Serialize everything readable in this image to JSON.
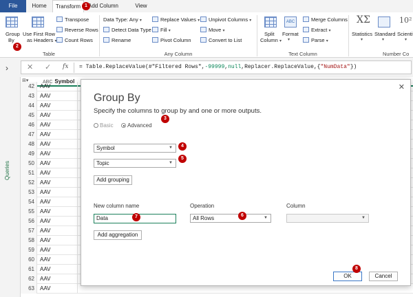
{
  "tabs": {
    "file": "File",
    "home": "Home",
    "transform": "Transform",
    "add_column": "Add Column",
    "view": "View"
  },
  "ribbon": {
    "group_by_line1": "Group",
    "group_by_line2": "By",
    "use_first_row_line1": "Use First Row",
    "use_first_row_line2": "as Headers",
    "transpose": "Transpose",
    "reverse_rows": "Reverse Rows",
    "count_rows": "Count Rows",
    "group_table": "Table",
    "data_type": "Data Type: Any",
    "detect_data_type": "Detect Data Type",
    "rename": "Rename",
    "replace_values": "Replace Values",
    "fill": "Fill",
    "pivot_column": "Pivot Column",
    "unpivot_columns": "Unpivot Columns",
    "move": "Move",
    "convert_to_list": "Convert to List",
    "group_any_column": "Any Column",
    "split_line1": "Split",
    "split_line2": "Column",
    "format": "Format",
    "merge_columns": "Merge Columns",
    "extract": "Extract",
    "parse": "Parse",
    "group_text_column": "Text Column",
    "statistics": "Statistics",
    "standard": "Standard",
    "scientific": "Scientific",
    "group_number_column": "Number Co",
    "abc_glyph": "ABC",
    "sigma_glyph": "XΣ",
    "exp_glyph": "10²"
  },
  "formula_bar": {
    "chevron": "›",
    "cancel_icon": "✕",
    "confirm_icon": "✓",
    "fx": "fx",
    "p1": "= Table.ReplaceValue(#\"Filtered Rows\",",
    "p2": "-99999",
    "p3": ",",
    "p4": "null",
    "p5": ",Replacer.ReplaceValue,{",
    "p6": "\"NumData\"",
    "p7": "})"
  },
  "queries_label": "Queries",
  "grid": {
    "type_icon": "ABC",
    "column": "Symbol",
    "rows": [
      {
        "n": "42",
        "v": "AAV"
      },
      {
        "n": "43",
        "v": "AAV"
      },
      {
        "n": "44",
        "v": "AAV"
      },
      {
        "n": "45",
        "v": "AAV"
      },
      {
        "n": "46",
        "v": "AAV"
      },
      {
        "n": "47",
        "v": "AAV"
      },
      {
        "n": "48",
        "v": "AAV"
      },
      {
        "n": "49",
        "v": "AAV"
      },
      {
        "n": "50",
        "v": "AAV"
      },
      {
        "n": "51",
        "v": "AAV"
      },
      {
        "n": "52",
        "v": "AAV"
      },
      {
        "n": "53",
        "v": "AAV"
      },
      {
        "n": "54",
        "v": "AAV"
      },
      {
        "n": "55",
        "v": "AAV"
      },
      {
        "n": "56",
        "v": "AAV"
      },
      {
        "n": "57",
        "v": "AAV"
      },
      {
        "n": "58",
        "v": "AAV"
      },
      {
        "n": "59",
        "v": "AAV"
      },
      {
        "n": "60",
        "v": "AAV"
      },
      {
        "n": "61",
        "v": "AAV"
      },
      {
        "n": "62",
        "v": "AAV"
      },
      {
        "n": "63",
        "v": "AAV"
      }
    ]
  },
  "dialog": {
    "title": "Group By",
    "subtitle": "Specify the columns to group by and one or more outputs.",
    "close": "✕",
    "basic": "Basic",
    "advanced": "Advanced",
    "group_field_1": "Symbol",
    "group_field_2": "Topic",
    "add_grouping": "Add grouping",
    "new_column_name_label": "New column name",
    "new_column_name_value": "Data",
    "operation_label": "Operation",
    "operation_value": "All Rows",
    "column_label": "Column",
    "column_value": "",
    "add_aggregation": "Add aggregation",
    "ok": "OK",
    "cancel": "Cancel"
  },
  "markers": [
    "1",
    "2",
    "3",
    "4",
    "5",
    "6",
    "7",
    "8"
  ],
  "colors": {
    "accent": "#217346",
    "file_tab": "#2b579a",
    "marker": "#c00000"
  }
}
